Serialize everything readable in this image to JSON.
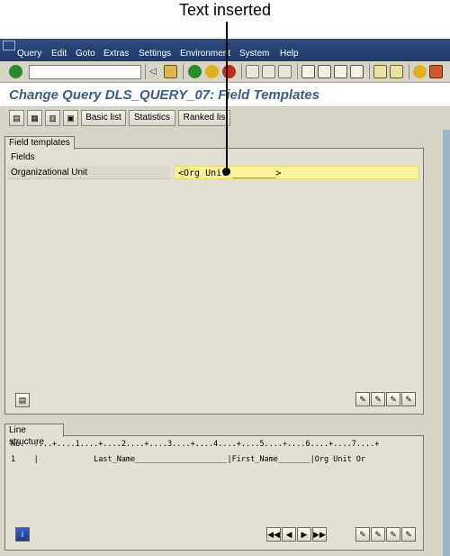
{
  "callout": {
    "text": "Text inserted"
  },
  "menubar": {
    "items": [
      "Query",
      "Edit",
      "Goto",
      "Extras",
      "Settings",
      "Environment",
      "System",
      "Help"
    ]
  },
  "toolbar": {
    "icons": [
      "check-icon",
      "command-field",
      "prev-icon",
      "save-icon",
      "back-icon",
      "exit-icon",
      "cancel-icon",
      "print-icon",
      "find-icon",
      "find-next-icon",
      "first-page-icon",
      "prev-page-icon",
      "next-page-icon",
      "last-page-icon",
      "new-session-icon",
      "shortcut-icon",
      "help-icon",
      "layout-icon"
    ]
  },
  "title": {
    "text": "Change Query DLS_QUERY_07: Field Templates"
  },
  "app_toolbar": {
    "basic_list": "Basic list",
    "statistics": "Statistics",
    "ranked_list": "Ranked lis"
  },
  "field_templates": {
    "tab": "Field templates",
    "fields_label": "Fields",
    "row_label": "Organizational Unit",
    "row_value": "<Org Unit ________>"
  },
  "line_structure": {
    "tab": "Line structure",
    "header": "No.  ....+....1....+....2....+....3....+....4....+....5....+....6....+....7....+",
    "row": "1    |            Last_Name____________________|First_Name_______|Org Unit Or"
  },
  "colors": {
    "title": "#3a5b8c",
    "menubar": "#1f3868",
    "highlight": "#fdf29a",
    "panel": "#e2e0d3"
  }
}
